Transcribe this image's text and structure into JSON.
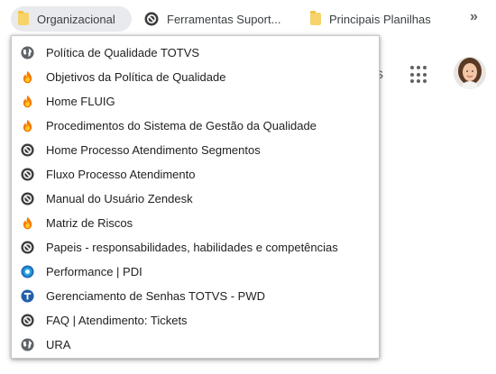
{
  "bookmarks_bar": {
    "items": [
      {
        "label": "Organizacional",
        "icon": "folder-icon"
      },
      {
        "label": "Ferramentas Suport...",
        "icon": "zendesk-icon"
      },
      {
        "label": "Principais Planilhas",
        "icon": "folder-icon"
      }
    ],
    "more": "»"
  },
  "page": {
    "partial_text": "s"
  },
  "menu": {
    "items": [
      {
        "label": "Política de Qualidade TOTVS",
        "icon": "globe-icon"
      },
      {
        "label": "Objetivos da Política de Qualidade",
        "icon": "fluig-icon"
      },
      {
        "label": "Home FLUIG",
        "icon": "fluig-icon"
      },
      {
        "label": "Procedimentos do Sistema de Gestão da Qualidade",
        "icon": "fluig-icon"
      },
      {
        "label": "Home Processo Atendimento Segmentos",
        "icon": "zendesk-icon"
      },
      {
        "label": "Fluxo Processo Atendimento",
        "icon": "zendesk-icon"
      },
      {
        "label": "Manual do Usuário Zendesk",
        "icon": "zendesk-icon"
      },
      {
        "label": "Matriz de Riscos",
        "icon": "fluig-icon"
      },
      {
        "label": "Papeis - responsabilidades, habilidades e competências",
        "icon": "zendesk-icon"
      },
      {
        "label": "Performance | PDI",
        "icon": "performance-icon"
      },
      {
        "label": "Gerenciamento de Senhas TOTVS - PWD",
        "icon": "totvs-icon"
      },
      {
        "label": "FAQ | Atendimento: Tickets",
        "icon": "zendesk-icon"
      },
      {
        "label": "URA",
        "icon": "globe-icon"
      }
    ]
  },
  "colors": {
    "fluig_orange": "#f57c00",
    "zendesk_dark": "#3c3c3c",
    "globe_gray": "#5f6368",
    "totvs_blue": "#1f5fa8",
    "folder_yellow": "#f8d36a"
  }
}
